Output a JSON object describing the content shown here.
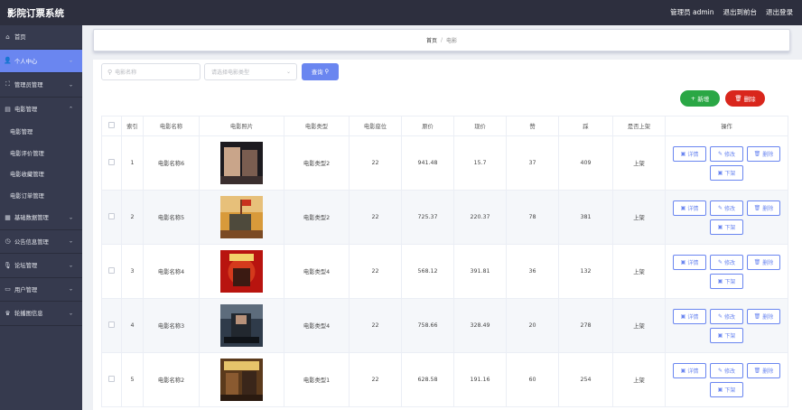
{
  "header": {
    "title": "影院订票系统",
    "user_label": "管理员 admin",
    "front_label": "退出到前台",
    "logout_label": "退出登录"
  },
  "sidebar": {
    "items": [
      {
        "label": "首页",
        "icon": "home-icon"
      },
      {
        "label": "个人中心",
        "icon": "user-icon"
      },
      {
        "label": "管理员管理",
        "icon": "frame-icon"
      },
      {
        "label": "电影管理",
        "icon": "document-icon"
      },
      {
        "label": "基础数据管理",
        "icon": "database-icon"
      },
      {
        "label": "公告信息管理",
        "icon": "clock-icon"
      },
      {
        "label": "论坛管理",
        "icon": "mic-icon"
      },
      {
        "label": "用户管理",
        "icon": "monitor-icon"
      },
      {
        "label": "轮播图信息",
        "icon": "trophy-icon"
      }
    ],
    "submenu": [
      "电影管理",
      "电影评价管理",
      "电影收藏管理",
      "电影订单管理"
    ]
  },
  "breadcrumb": {
    "home": "首页",
    "sep": "/",
    "current": "电影"
  },
  "search": {
    "name_placeholder": "电影名称",
    "type_placeholder": "请选择电影类型",
    "query_label": "查询"
  },
  "actions": {
    "add_label": "新增",
    "delete_label": "删除"
  },
  "table": {
    "headers": [
      "索引",
      "电影名称",
      "电影照片",
      "电影类型",
      "电影座位",
      "原价",
      "现价",
      "赞",
      "踩",
      "是否上架",
      "操作"
    ],
    "rows": [
      {
        "index": "1",
        "name": "电影名称6",
        "type": "电影类型2",
        "seats": "22",
        "orig": "941.48",
        "now": "15.7",
        "up": "37",
        "down": "409",
        "status": "上架"
      },
      {
        "index": "2",
        "name": "电影名称5",
        "type": "电影类型2",
        "seats": "22",
        "orig": "725.37",
        "now": "220.37",
        "up": "78",
        "down": "381",
        "status": "上架"
      },
      {
        "index": "3",
        "name": "电影名称4",
        "type": "电影类型4",
        "seats": "22",
        "orig": "568.12",
        "now": "391.81",
        "up": "36",
        "down": "132",
        "status": "上架"
      },
      {
        "index": "4",
        "name": "电影名称3",
        "type": "电影类型4",
        "seats": "22",
        "orig": "758.66",
        "now": "328.49",
        "up": "20",
        "down": "278",
        "status": "上架"
      },
      {
        "index": "5",
        "name": "电影名称2",
        "type": "电影类型1",
        "seats": "22",
        "orig": "628.58",
        "now": "191.16",
        "up": "60",
        "down": "254",
        "status": "上架"
      }
    ],
    "ops": {
      "detail": "详情",
      "edit": "修改",
      "delete": "删除",
      "offshelf": "下架"
    }
  },
  "colors": {
    "accent": "#6a86f0",
    "sidebar": "#363a4e",
    "topbar": "#2d2f3e",
    "add": "#2aa745",
    "danger": "#d9261c"
  }
}
